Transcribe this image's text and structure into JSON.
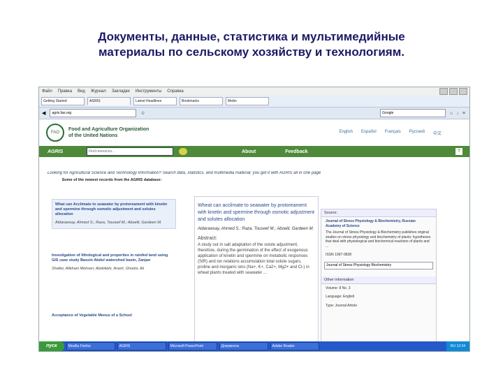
{
  "slide": {
    "title_line1": "Документы, данные, статистика и мультимедийные",
    "title_line2": "материалы по сельскому хозяйству и технологиям."
  },
  "browser": {
    "menu": [
      "Файл",
      "Правка",
      "Вид",
      "Журнал",
      "Закладки",
      "Инструменты",
      "Справка"
    ],
    "tabs": [
      "Getting Started",
      "AGRIS",
      "Latest Headlines",
      "Bookmarks",
      "Мейл"
    ],
    "url": "agris.fao.org",
    "search_placeholder": "Google"
  },
  "fao": {
    "logo": "FAO",
    "name_line1": "Food and Agriculture Organization",
    "name_line2": "of the United Nations",
    "languages": [
      "English",
      "Español",
      "Français",
      "Русский",
      "中文"
    ]
  },
  "agris": {
    "logo": "AGRIS",
    "search_placeholder": "Find resources...",
    "nav": [
      "About",
      "Feedback"
    ],
    "help": "?"
  },
  "tagline": "Looking for Agricultural Science and Technology Information? Search data, statistics, and multimedia material; you get it with AGRIS all in one page",
  "intro": "Some of the newest records from the AGRIS database:",
  "records": [
    {
      "title": "What can Acclimate to seawater by protoreament with kinetin and spermine through osmotic adjustment and solutes allocation",
      "authors": "Aldarawsay, Ahmed S.; Raza, Touseef M.; Aboelil, Gardeen M."
    },
    {
      "title": "Investigation of lithological and properties in rainfed land using GIS case study Bassin Abdul watershed basin, Zanjan",
      "authors": "Shafiei, Alikhani Mohsen; Abdollahi, Arash; Ghodsi, Ali"
    },
    {
      "title": "Acceptance of Vegetable Menus of a School",
      "authors": ""
    }
  ],
  "detail": {
    "title": "Wheat can acclimate to seawater by protoreament with kinetin and spermine through osmotic adjustment and solutes allocation",
    "authors": "Aldarawsay, Ahmed S.; Raza, Touseef M.; Aboelil, Gardeen M.",
    "abstract_label": "Abstract:",
    "abstract": "A study out in salt adaptation of the solute adjustment, therefore, during the germination of the effect of exogenous application of kinetin and spermine on metabolic responses (SIR) and ion relations accumulation total solute sugars, proline and inorganic ions (Na+, K+, Ca2+, Mg2+ and Cl-) in wheat plants treated with seawater ..."
  },
  "side": {
    "source_label": "Source:",
    "source_text": "Journal of Stress Physiology & Biochemistry",
    "source_bold": "Journal of Stress Physiology & Biochemistry, Russian Academy of Science",
    "note": "The Journal of Stress Physiology & Biochemistry publishes original studies on stress physiology and biochemistry of plants; hypotheses that deal with physiological and biochemical reactions of plants and ...",
    "link": "ISSN 1997-0838",
    "select": "Journal of Stress Physiology Biochemistry",
    "other_label": "Other information",
    "other_lines": [
      "Volume: 8 No. 3",
      "Language: English",
      "Type: Journal Article"
    ]
  },
  "taskbar": {
    "start": "пуск",
    "tasks": [
      "Mozilla Firefox",
      "AGRIS",
      "Microsoft PowerPoint",
      "Документы",
      "Adobe Reader"
    ],
    "tray": "RU 12:34"
  }
}
